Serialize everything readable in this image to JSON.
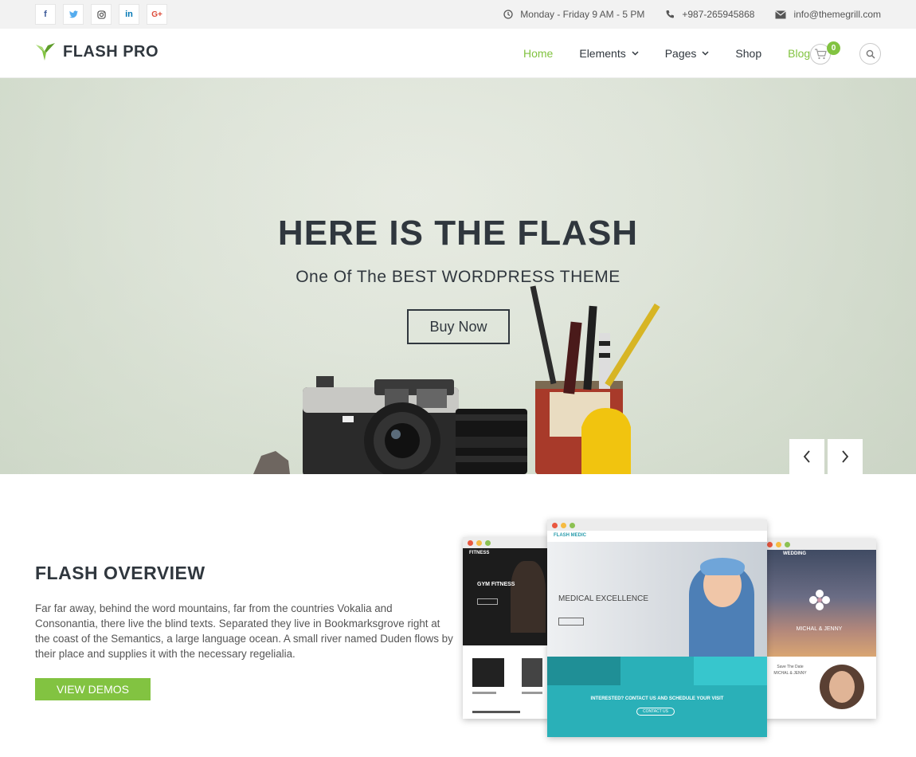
{
  "topbar": {
    "social": [
      "f",
      "t",
      "ig",
      "in",
      "G+"
    ],
    "hours": "Monday - Friday 9 AM - 5 PM",
    "phone": "+987-265945868",
    "email": "info@themegrill.com"
  },
  "header": {
    "logo": "FLASH PRO",
    "nav": [
      "Home",
      "Elements",
      "Pages",
      "Shop",
      "Blog"
    ],
    "cart_count": "0"
  },
  "hero": {
    "title": "HERE IS THE FLASH",
    "subtitle": "One Of The BEST WORDPRESS THEME",
    "button": "Buy Now"
  },
  "overview": {
    "title": "FLASH OVERVIEW",
    "text": "Far far away, behind the word mountains, far from the countries Vokalia and Consonantia, there live the blind texts. Separated they live in Bookmarksgrove right at the coast of the Semantics, a large language ocean. A small river named Duden flows by their place and supplies it with the necessary regelialia.",
    "button": "VIEW DEMOS"
  },
  "demos": {
    "fitness_logo": "FITNESS",
    "fitness_heading": "GYM FITNESS",
    "medic_logo": "FLASH MEDIC",
    "medic_heading": "MEDICAL EXCELLENCE",
    "medic_cta": "INTERESTED? CONTACT US AND SCHEDULE YOUR VISIT",
    "medic_cta_button": "CONTACT US",
    "wedding_logo": "WEDDING",
    "wedding_names": "MICHAL & JENNY",
    "wedding_save": "Save The Date",
    "wedding_names2": "MICHAL & JENNY"
  },
  "colors": {
    "accent": "#82c341",
    "dark": "#30373e"
  }
}
